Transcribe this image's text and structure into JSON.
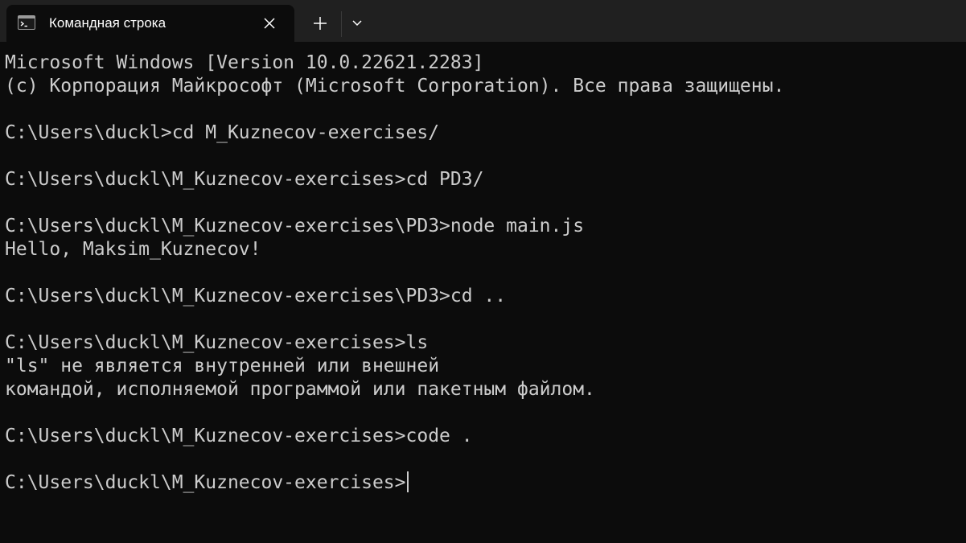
{
  "window": {
    "tab_title": "Командная строка",
    "tab_icon": "console-icon",
    "close_icon": "close-icon",
    "new_tab_icon": "plus-icon",
    "dropdown_icon": "chevron-down-icon"
  },
  "colors": {
    "terminal_bg": "#0c0c0c",
    "tabbar_bg": "#202020",
    "text": "#cccccc"
  },
  "terminal": {
    "lines": [
      "Microsoft Windows [Version 10.0.22621.2283]",
      "(c) Корпорация Майкрософт (Microsoft Corporation). Все права защищены.",
      "",
      "C:\\Users\\duckl>cd M_Kuznecov-exercises/",
      "",
      "C:\\Users\\duckl\\M_Kuznecov-exercises>cd PD3/",
      "",
      "C:\\Users\\duckl\\M_Kuznecov-exercises\\PD3>node main.js",
      "Hello, Maksim_Kuznecov!",
      "",
      "C:\\Users\\duckl\\M_Kuznecov-exercises\\PD3>cd ..",
      "",
      "C:\\Users\\duckl\\M_Kuznecov-exercises>ls",
      "\"ls\" не является внутренней или внешней",
      "командой, исполняемой программой или пакетным файлом.",
      "",
      "C:\\Users\\duckl\\M_Kuznecov-exercises>code .",
      "",
      "C:\\Users\\duckl\\M_Kuznecov-exercises>"
    ]
  }
}
